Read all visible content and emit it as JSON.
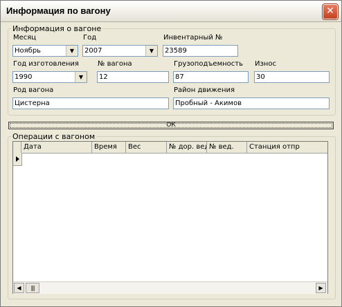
{
  "window": {
    "title": "Информация по вагону",
    "close_glyph": "✕"
  },
  "info": {
    "legend": "Информация о вагоне",
    "month": {
      "label": "Месяц",
      "value": "Ноябрь"
    },
    "year": {
      "label": "Год",
      "value": "2007"
    },
    "inventory": {
      "label": "Инвентарный №",
      "value": "23589"
    },
    "build_year": {
      "label": "Год изготовления",
      "value": "1990"
    },
    "wagon_no": {
      "label": "№ вагона",
      "value": "12"
    },
    "capacity": {
      "label": "Грузоподъемность",
      "value": "87"
    },
    "wear": {
      "label": "Износ",
      "value": "30"
    },
    "wagon_type": {
      "label": "Род вагона",
      "value": "Цистерна"
    },
    "district": {
      "label": "Район движения",
      "value": "Пробный - Акимов"
    }
  },
  "ok_button": {
    "label": "ОК"
  },
  "operations": {
    "legend": "Операции с вагоном",
    "columns": [
      "Дата",
      "Время",
      "Вес",
      "№ дор. вед.",
      "№ вед.",
      "Станция отпр"
    ],
    "rows": [],
    "current_row_marker": "▶"
  },
  "icons": {
    "dropdown": "chevron-down-icon",
    "scroll_left": "arrow-left-icon",
    "scroll_right": "arrow-right-icon"
  },
  "colors": {
    "window_bg": "#ece9d8",
    "input_border": "#7f9db9",
    "close_button": "#c1401f"
  }
}
